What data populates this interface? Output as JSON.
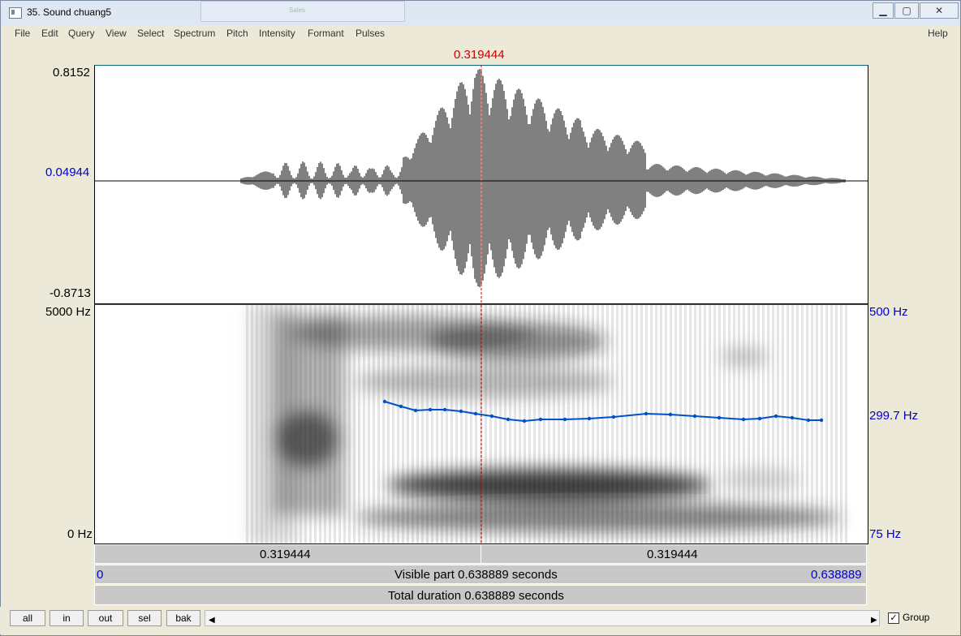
{
  "window": {
    "title": "35. Sound chuang5"
  },
  "menu": {
    "file": "File",
    "edit": "Edit",
    "query": "Query",
    "view": "View",
    "select": "Select",
    "spectrum": "Spectrum",
    "pitch": "Pitch",
    "intensity": "Intensity",
    "formant": "Formant",
    "pulses": "Pulses",
    "help": "Help"
  },
  "cursor": {
    "time": "0.319444"
  },
  "waveform": {
    "max": "0.8152",
    "cursor_value": "0.04944",
    "min": "-0.8713"
  },
  "spectrogram": {
    "top_freq": "5000 Hz",
    "bottom_freq": "0 Hz"
  },
  "pitch": {
    "top": "500 Hz",
    "cursor_value": "299.7 Hz",
    "bottom": "75 Hz",
    "color": "#0050c8"
  },
  "time_bar": {
    "left": "0.319444",
    "right": "0.319444"
  },
  "visible_bar": {
    "start": "0",
    "label": "Visible part 0.638889 seconds",
    "end": "0.638889"
  },
  "total_bar": {
    "label": "Total duration 0.638889 seconds"
  },
  "nav": {
    "all": "all",
    "in": "in",
    "out": "out",
    "sel": "sel",
    "bak": "bak"
  },
  "group": {
    "label": "Group",
    "checked": true
  }
}
